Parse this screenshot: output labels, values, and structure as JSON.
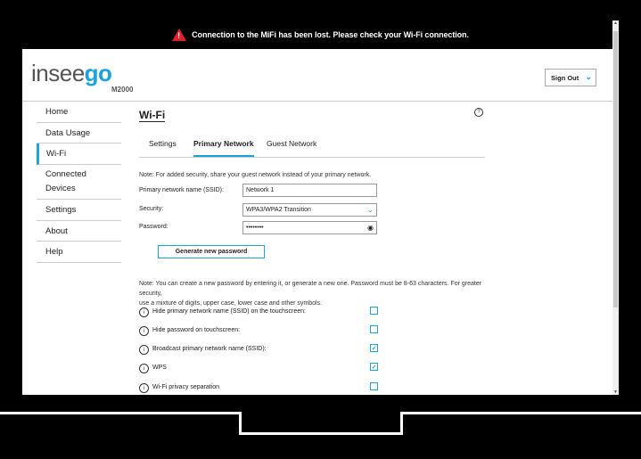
{
  "alert": {
    "text": "Connection to the MiFi has been lost. Please check your Wi-Fi connection."
  },
  "header": {
    "brand_prefix": "insee",
    "brand_suffix": "go",
    "model": "M2000",
    "signout_label": "Sign Out"
  },
  "sidebar": {
    "items": [
      {
        "label": "Home"
      },
      {
        "label": "Data Usage"
      },
      {
        "label": "Wi-Fi"
      },
      {
        "label": "Connected Devices"
      },
      {
        "label": "Settings"
      },
      {
        "label": "About"
      },
      {
        "label": "Help"
      }
    ],
    "active": "Wi-Fi"
  },
  "main": {
    "title": "Wi-Fi",
    "tabs": [
      {
        "label": "Settings"
      },
      {
        "label": "Primary Network"
      },
      {
        "label": "Guest Network"
      }
    ],
    "active_tab": "Primary Network",
    "note_top": "Note: For added security, share your guest network instead of your primary network.",
    "fields": {
      "ssid_label": "Primary network name (SSID):",
      "ssid_value": "Network 1",
      "security_label": "Security:",
      "security_value": "WPA3/WPA2 Transition",
      "password_label": "Password:",
      "password_value": "••••••••"
    },
    "generate_label": "Generate new password",
    "note_bottom_line1": "Note: You can create a new password by entering it, or generate a new one. Password must be 8-63 characters. For greater security,",
    "note_bottom_line2": "use a mixture of digits, upper case, lower case and other symbols.",
    "options": [
      {
        "label": "Hide primary network name (SSID) on the touchscreen:",
        "checked": false
      },
      {
        "label": "Hide password on touchscreen:",
        "checked": false
      },
      {
        "label": "Broadcast primary network name (SSID):",
        "checked": true
      },
      {
        "label": "WPS",
        "checked": true
      },
      {
        "label": "Wi-Fi privacy separation",
        "checked": false
      }
    ]
  },
  "colors": {
    "accent": "#1aa3dc",
    "alert_icon": "#e3202a",
    "frame": "#000000"
  }
}
